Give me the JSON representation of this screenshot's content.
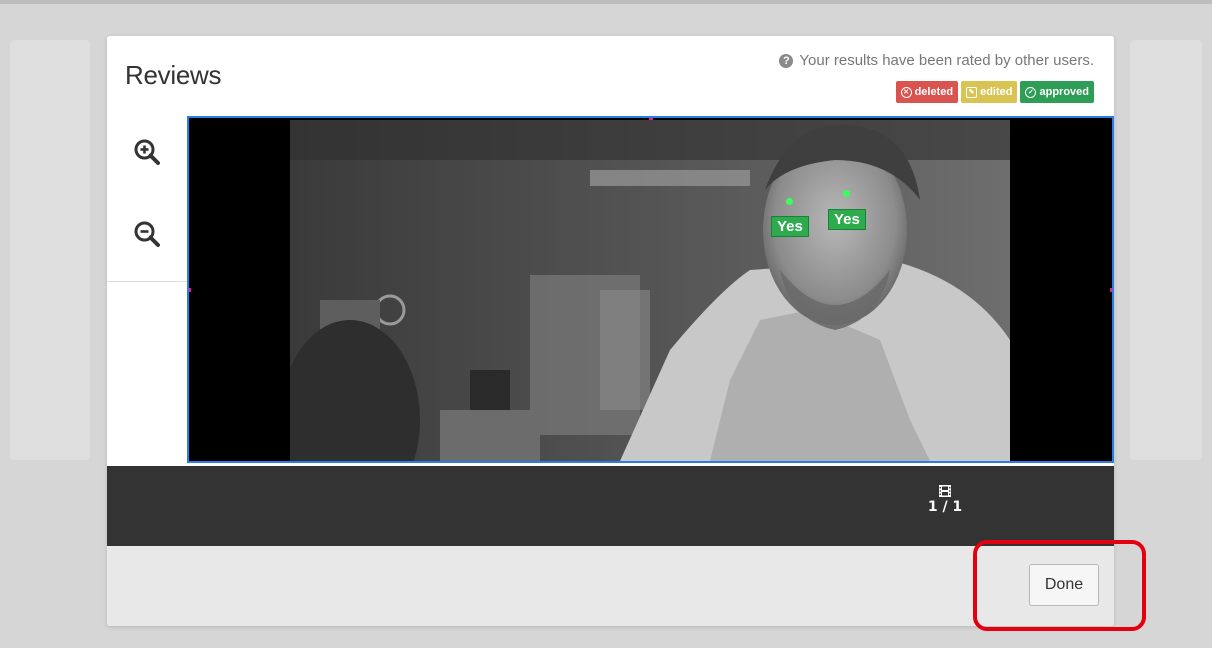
{
  "modal": {
    "title": "Reviews",
    "rating_notice": "Your results have been rated by other users.",
    "badges": [
      {
        "label": "deleted",
        "color": "#d9534f",
        "icon": "times-circle-icon"
      },
      {
        "label": "edited",
        "color": "#d9c353",
        "icon": "edit-icon"
      },
      {
        "label": "approved",
        "color": "#2e9e56",
        "icon": "check-circle-icon"
      }
    ]
  },
  "toolbar": {
    "zoom_in_icon": "zoom-in-icon",
    "zoom_out_icon": "zoom-out-icon"
  },
  "annotations": [
    {
      "label": "Yes"
    },
    {
      "label": "Yes"
    }
  ],
  "filmstrip": {
    "icon": "film-icon",
    "counter": "1 / 1"
  },
  "footer": {
    "done_label": "Done"
  },
  "colors": {
    "accent_blue": "#2b7de9",
    "highlight_red": "#e3000f",
    "annotation_green": "#2eaa4f"
  }
}
